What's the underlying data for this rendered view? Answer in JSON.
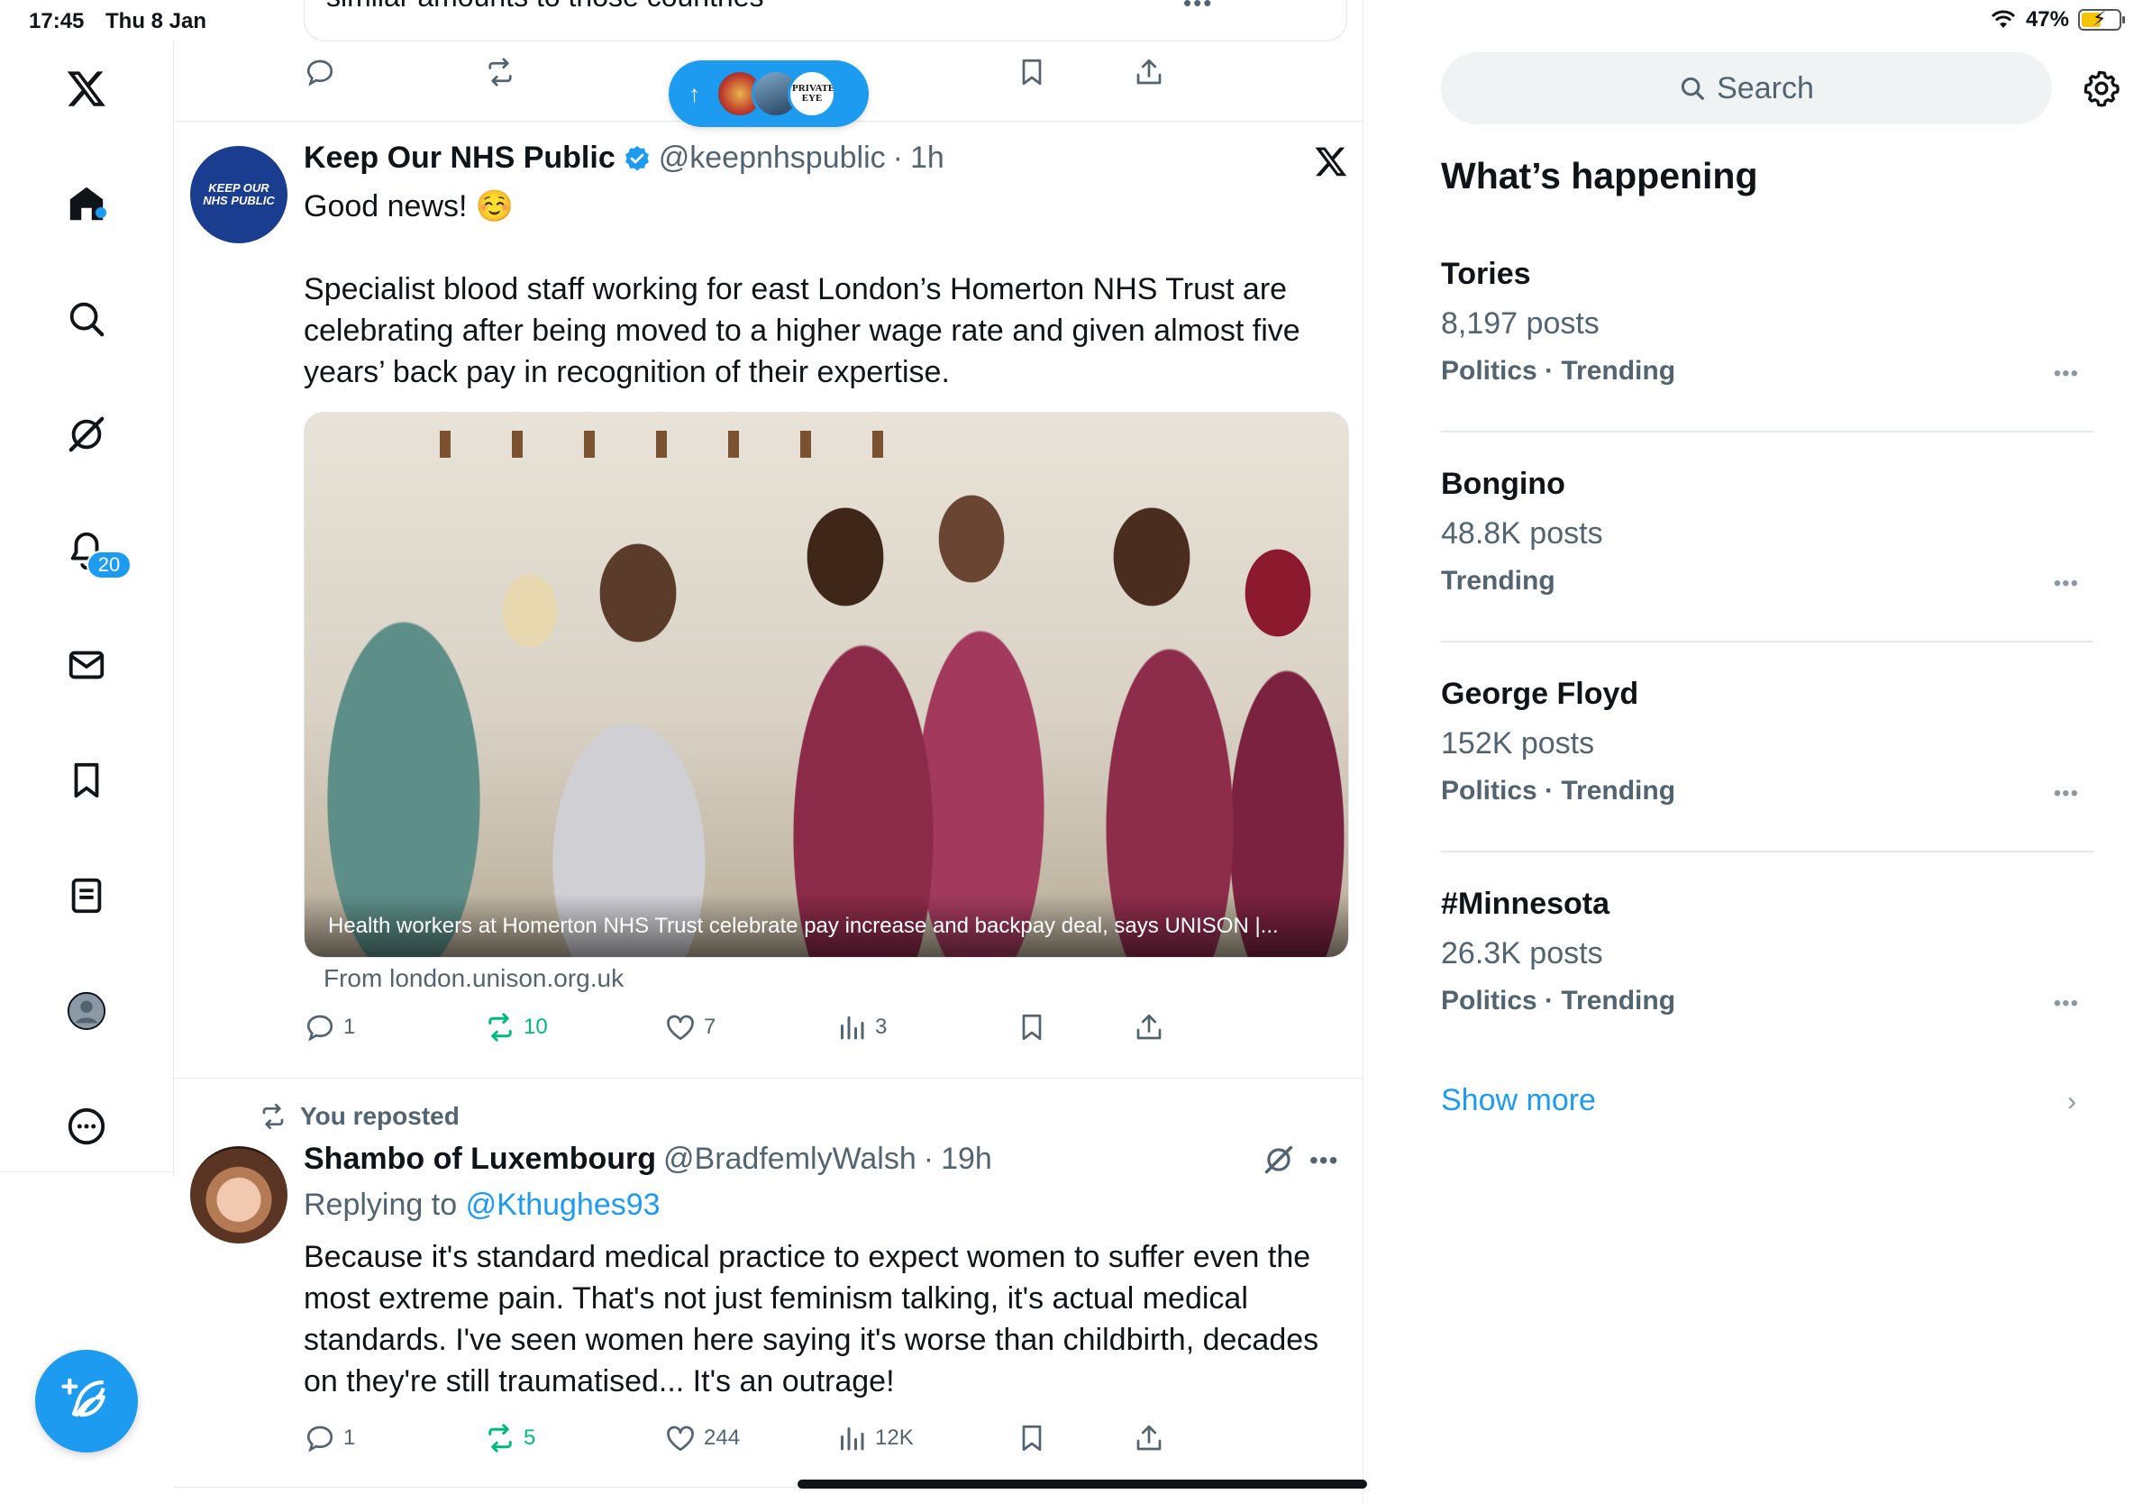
{
  "status_bar": {
    "time": "17:45",
    "date": "Thu 8 Jan",
    "battery": "47%"
  },
  "nav": {
    "notifications_count": "20"
  },
  "new_posts_pill": {
    "avatar3_text": "PRIVATE EYE"
  },
  "prev_tweet": {
    "cut_text": "similar amounts to those countries",
    "more": "•••"
  },
  "tweet1": {
    "avatar_text": "KEEP OUR NHS PUBLIC",
    "name": "Keep Our NHS Public",
    "handle": "@keepnhspublic",
    "dot": "·",
    "time": "1h",
    "text": "Good news! ☺️\n\nSpecialist blood staff working for east London’s Homerton NHS Trust are celebrating after being moved to a higher wage rate and given almost five years’ back pay in recognition of their expertise.",
    "media_caption": "Health workers at Homerton NHS Trust celebrate pay increase and backpay deal, says UNISON |...",
    "from_link": "From london.unison.org.uk",
    "replies": "1",
    "reposts": "10",
    "likes": "7",
    "views": "3"
  },
  "tweet2": {
    "reposted_label": "You reposted",
    "name": "Shambo of Luxembourg",
    "handle": "@BradfemlyWalsh",
    "dot": "·",
    "time": "19h",
    "replying_prefix": "Replying to",
    "replying_to": "@Kthughes93",
    "more": "•••",
    "text": "Because it's standard medical practice to expect women to suffer even the most extreme pain. That's not just feminism talking, it's actual medical standards. I've seen women here saying it's worse than childbirth, decades on they're still traumatised... It's an outrage!",
    "replies": "1",
    "reposts": "5",
    "likes": "244",
    "views": "12K"
  },
  "search": {
    "placeholder": "Search"
  },
  "whats_happening": {
    "title": "What’s happening",
    "trends": [
      {
        "name": "Tories",
        "posts": "8,197 posts",
        "category": "Politics · Trending"
      },
      {
        "name": "Bongino",
        "posts": "48.8K posts",
        "category": "Trending"
      },
      {
        "name": "George Floyd",
        "posts": "152K posts",
        "category": "Politics · Trending"
      },
      {
        "name": "#Minnesota",
        "posts": "26.3K posts",
        "category": "Politics · Trending"
      }
    ],
    "trend_more": "•••",
    "show_more": "Show more"
  },
  "colors": {
    "accent": "#1d9bf0",
    "repost_green": "#00ba7c",
    "secondary_text": "#536471"
  },
  "icons": [
    "x-logo-icon",
    "home-icon",
    "search-icon",
    "grok-icon",
    "bell-icon",
    "mail-icon",
    "bookmark-icon",
    "lists-icon",
    "profile-icon",
    "more-circle-icon",
    "compose-icon",
    "reply-icon",
    "repost-icon",
    "like-icon",
    "views-icon",
    "share-icon",
    "verified-icon",
    "gear-icon",
    "wifi-icon",
    "battery-icon"
  ]
}
